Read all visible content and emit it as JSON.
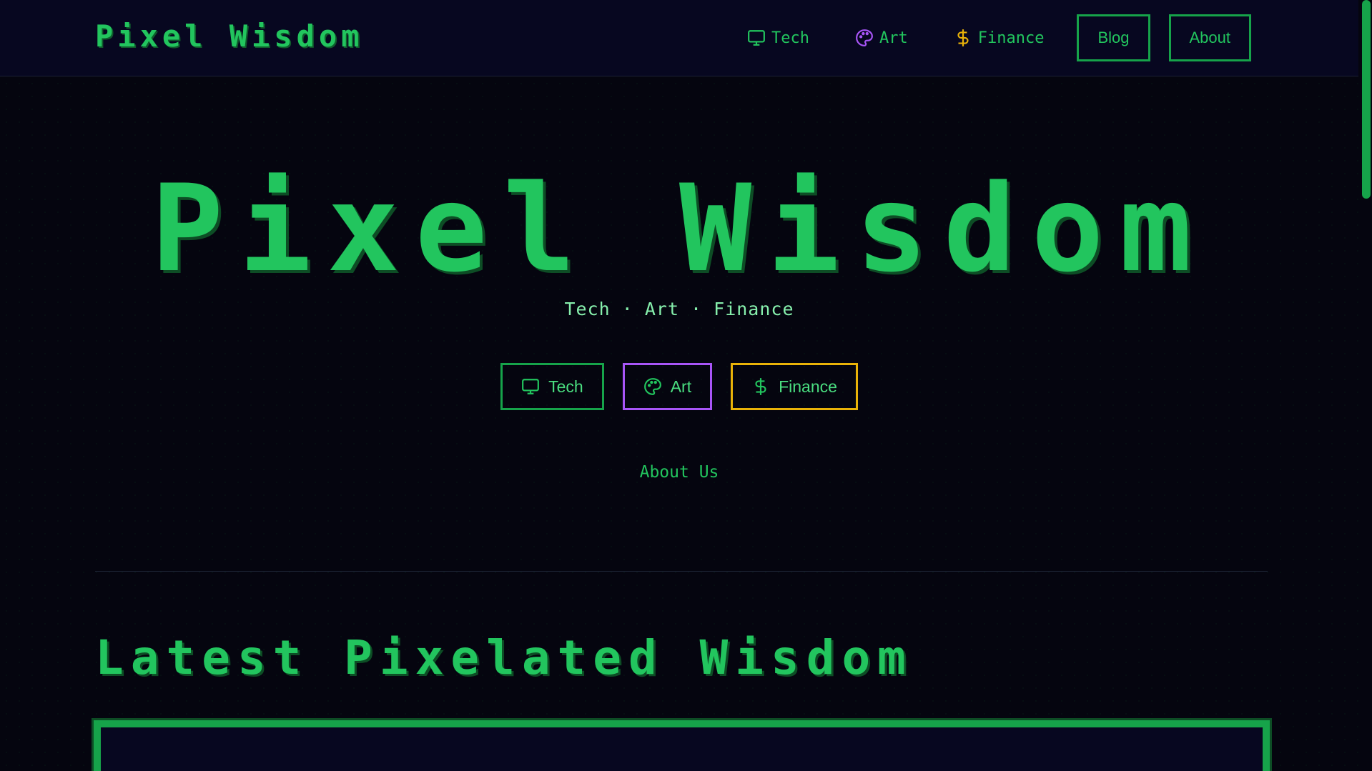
{
  "header": {
    "brand": "Pixel Wisdom",
    "nav": [
      {
        "label": "Tech",
        "icon": "monitor-icon",
        "color": "#22c55e"
      },
      {
        "label": "Art",
        "icon": "palette-icon",
        "color": "#a855f7"
      },
      {
        "label": "Finance",
        "icon": "dollar-icon",
        "color": "#eab308"
      }
    ],
    "buttons": {
      "blog": "Blog",
      "about": "About"
    }
  },
  "hero": {
    "title": "Pixel Wisdom",
    "tagline": "Tech · Art · Finance",
    "categories": [
      {
        "label": "Tech",
        "icon": "monitor-icon",
        "border": "#16a34a"
      },
      {
        "label": "Art",
        "icon": "palette-icon",
        "border": "#a855f7"
      },
      {
        "label": "Finance",
        "icon": "dollar-icon",
        "border": "#eab308"
      }
    ],
    "about_link": "About Us"
  },
  "latest": {
    "title": "Latest Pixelated Wisdom"
  },
  "colors": {
    "accent": "#22c55e",
    "background": "#05050f",
    "header_bg": "#070720"
  }
}
